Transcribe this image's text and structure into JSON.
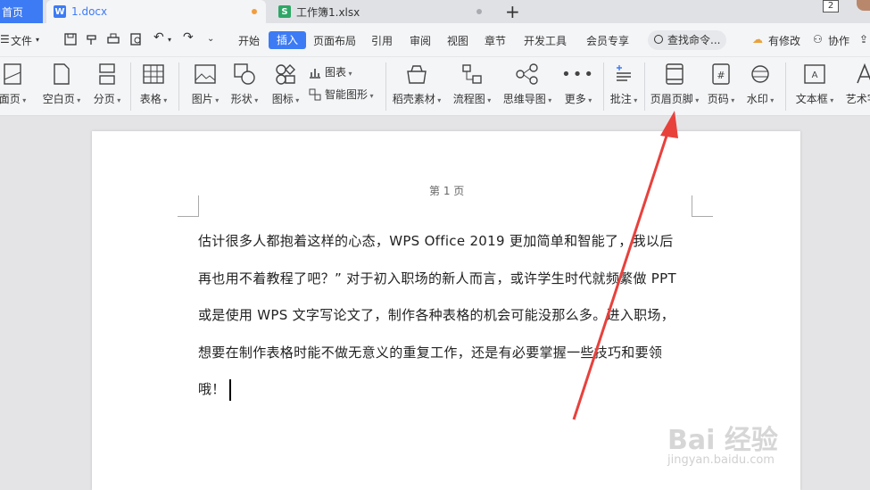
{
  "tabs": {
    "home": "首页",
    "doc": "1.docx",
    "xls": "工作簿1.xlsx",
    "window_count": "2"
  },
  "menu": {
    "file": "文件",
    "items": [
      "开始",
      "插入",
      "页面布局",
      "引用",
      "审阅",
      "视图",
      "章节",
      "开发工具",
      "会员专享"
    ],
    "active": "插入",
    "search": "查找命令...",
    "modified": "有修改",
    "collab": "协作"
  },
  "ribbon": {
    "cover": "面页",
    "blank": "空白页",
    "pagebreak": "分页",
    "table": "表格",
    "picture": "图片",
    "shape": "形状",
    "icon": "图标",
    "chart": "图表",
    "smartart": "智能图形",
    "material": "稻壳素材",
    "flowchart": "流程图",
    "mindmap": "思维导图",
    "more": "更多",
    "comment": "批注",
    "headerfooter": "页眉页脚",
    "pagenum": "页码",
    "watermark": "水印",
    "textbox": "文本框",
    "wordart": "艺术字"
  },
  "document": {
    "header": "第 1 页",
    "lines": [
      "估计很多人都抱着这样的心态，WPS Office 2019 更加简单和智能了，我以后",
      "再也用不着教程了吧？” 对于初入职场的新人而言，或许学生时代就频繁做 PPT",
      "或是使用 WPS 文字写论文了，制作各种表格的机会可能没那么多。进入职场，",
      "想要在制作表格时能不做无意义的重复工作，还是有必要掌握一些技巧和要领",
      "哦！"
    ]
  },
  "watermark": {
    "brand": "Bai 经验",
    "url": "jingyan.baidu.com"
  },
  "colors": {
    "accent": "#3d7bf5",
    "arrow": "#e8413c",
    "excel": "#2ea766"
  }
}
